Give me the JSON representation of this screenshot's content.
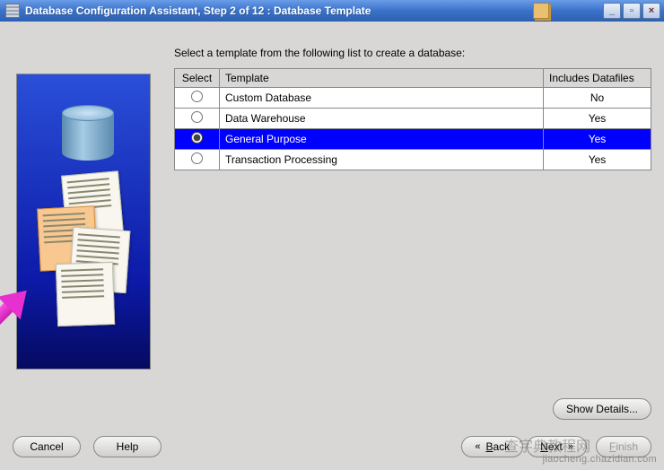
{
  "window": {
    "title": "Database Configuration Assistant, Step 2 of 12 : Database Template"
  },
  "instruction": "Select a template from the following list to create a database:",
  "table": {
    "headers": {
      "select": "Select",
      "template": "Template",
      "includes": "Includes Datafiles"
    },
    "rows": [
      {
        "template": "Custom Database",
        "includes": "No",
        "selected": false
      },
      {
        "template": "Data Warehouse",
        "includes": "Yes",
        "selected": false
      },
      {
        "template": "General Purpose",
        "includes": "Yes",
        "selected": true
      },
      {
        "template": "Transaction Processing",
        "includes": "Yes",
        "selected": false
      }
    ]
  },
  "buttons": {
    "show_details": "Show Details...",
    "cancel": "Cancel",
    "help": "Help",
    "back_prefix": "B",
    "back_suffix": "ack",
    "next_prefix": "N",
    "next_suffix": "ext",
    "finish_prefix": "F",
    "finish_suffix": "inish"
  },
  "watermark": {
    "cn": "查字典",
    "url": "教程网",
    "domain": "jiaocheng.chazidian.com"
  }
}
